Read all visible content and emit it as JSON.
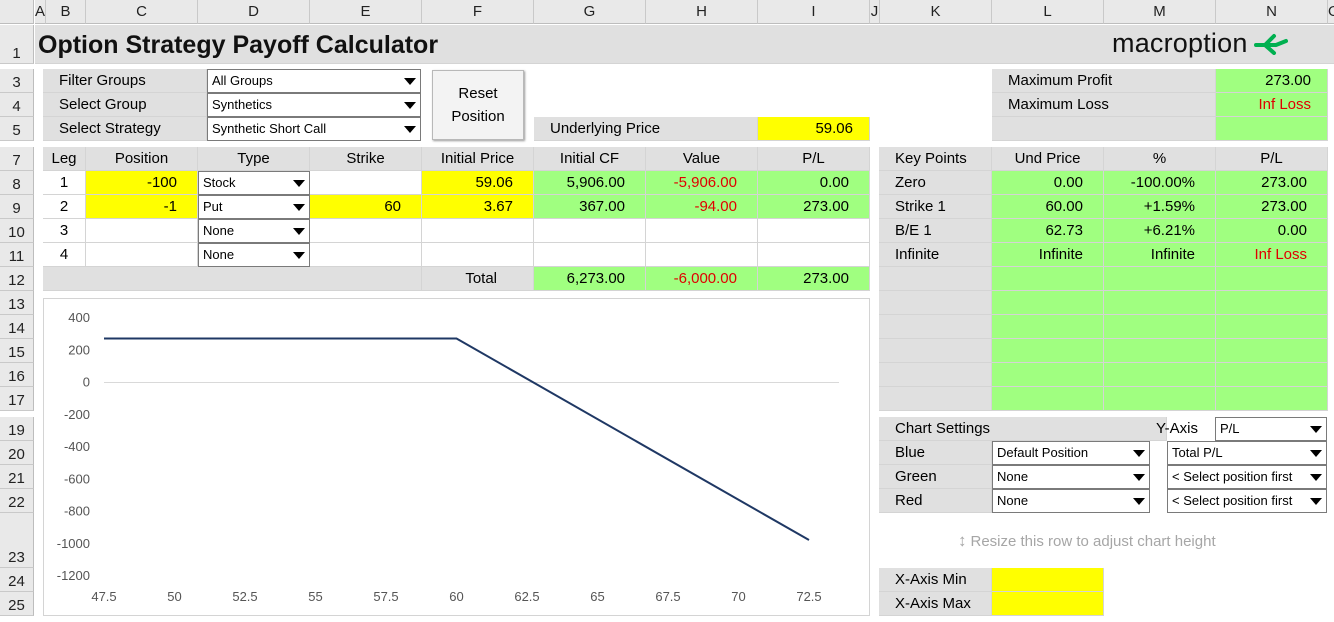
{
  "title": "Option Strategy Payoff Calculator",
  "logo": {
    "text": "macroption",
    "accent": "#00b050"
  },
  "columns": [
    "A",
    "B",
    "C",
    "D",
    "E",
    "F",
    "G",
    "H",
    "I",
    "J",
    "K",
    "L",
    "M",
    "N",
    "O"
  ],
  "rows": [
    "1",
    "3",
    "4",
    "5",
    "7",
    "8",
    "9",
    "10",
    "11",
    "12",
    "13",
    "14",
    "15",
    "16",
    "17",
    "19",
    "20",
    "21",
    "22",
    "23",
    "24",
    "25"
  ],
  "selectors": {
    "filter_groups": {
      "label": "Filter Groups",
      "value": "All Groups"
    },
    "select_group": {
      "label": "Select Group",
      "value": "Synthetics"
    },
    "select_strategy": {
      "label": "Select Strategy",
      "value": "Synthetic Short Call"
    }
  },
  "reset_button": {
    "line1": "Reset",
    "line2": "Position"
  },
  "underlying": {
    "label": "Underlying Price",
    "value": "59.06"
  },
  "summary": {
    "max_profit_label": "Maximum Profit",
    "max_profit": "273.00",
    "max_loss_label": "Maximum Loss",
    "max_loss": "Inf Loss"
  },
  "legs_table": {
    "headers": [
      "Leg",
      "Position",
      "Type",
      "Strike",
      "Initial Price",
      "Initial CF",
      "Value",
      "P/L"
    ],
    "rows": [
      {
        "leg": "1",
        "position": "-100",
        "type": "Stock",
        "strike": "",
        "price": "59.06",
        "cf": "5,906.00",
        "value": "-5,906.00",
        "pl": "0.00"
      },
      {
        "leg": "2",
        "position": "-1",
        "type": "Put",
        "strike": "60",
        "price": "3.67",
        "cf": "367.00",
        "value": "-94.00",
        "pl": "273.00"
      },
      {
        "leg": "3",
        "position": "",
        "type": "None",
        "strike": "",
        "price": "",
        "cf": "",
        "value": "",
        "pl": ""
      },
      {
        "leg": "4",
        "position": "",
        "type": "None",
        "strike": "",
        "price": "",
        "cf": "",
        "value": "",
        "pl": ""
      }
    ],
    "total": {
      "label": "Total",
      "cf": "6,273.00",
      "value": "-6,000.00",
      "pl": "273.00"
    }
  },
  "key_points": {
    "headers": [
      "Key Points",
      "Und Price",
      "%",
      "P/L"
    ],
    "rows": [
      {
        "name": "Zero",
        "price": "0.00",
        "pct": "-100.00%",
        "pl": "273.00"
      },
      {
        "name": "Strike 1",
        "price": "60.00",
        "pct": "+1.59%",
        "pl": "273.00"
      },
      {
        "name": "B/E 1",
        "price": "62.73",
        "pct": "+6.21%",
        "pl": "0.00"
      },
      {
        "name": "Infinite",
        "price": "Infinite",
        "pct": "Infinite",
        "pl": "Inf Loss"
      }
    ]
  },
  "chart_settings": {
    "label": "Chart Settings",
    "yaxis_label": "Y-Axis",
    "yaxis_value": "P/L",
    "rows": [
      {
        "label": "Blue",
        "position": "Default Position",
        "series": "Total P/L"
      },
      {
        "label": "Green",
        "position": "None",
        "series": "< Select position first"
      },
      {
        "label": "Red",
        "position": "None",
        "series": "< Select position first"
      }
    ]
  },
  "resize_hint": "Resize this row to adjust chart height",
  "xaxis": {
    "min_label": "X-Axis Min",
    "max_label": "X-Axis Max",
    "min_value": "",
    "max_value": ""
  },
  "chart_data": {
    "type": "line",
    "title": "",
    "xlabel": "",
    "ylabel": "",
    "xlim": [
      47.5,
      72.5
    ],
    "ylim": [
      -1200,
      400
    ],
    "xticks": [
      "47.5",
      "50",
      "52.5",
      "55",
      "57.5",
      "60",
      "62.5",
      "65",
      "67.5",
      "70",
      "72.5"
    ],
    "yticks": [
      "400",
      "200",
      "0",
      "-200",
      "-400",
      "-600",
      "-800",
      "-1000",
      "-1200"
    ],
    "series": [
      {
        "x": [
          47.5,
          60,
          62.73,
          72.5
        ],
        "y": [
          273,
          273,
          0,
          -977
        ],
        "color": "#1f3864"
      }
    ],
    "grid": "horizontal"
  }
}
